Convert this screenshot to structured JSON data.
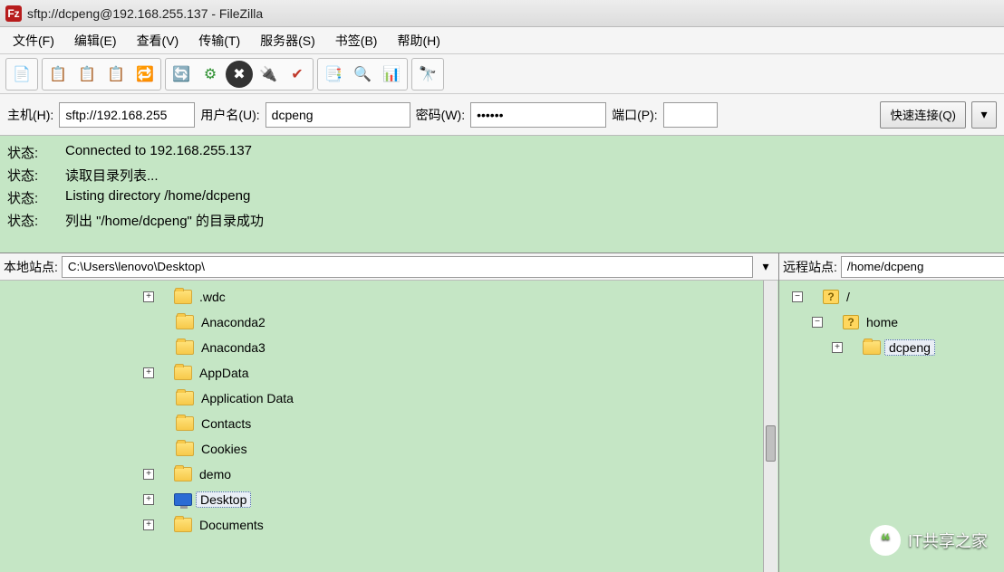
{
  "title": "sftp://dcpeng@192.168.255.137 - FileZilla",
  "menu": {
    "file": "文件(F)",
    "edit": "编辑(E)",
    "view": "查看(V)",
    "transfer": "传输(T)",
    "server": "服务器(S)",
    "bookmarks": "书签(B)",
    "help": "帮助(H)"
  },
  "quickconnect": {
    "host_label": "主机(H):",
    "host_value": "sftp://192.168.255",
    "user_label": "用户名(U):",
    "user_value": "dcpeng",
    "pass_label": "密码(W):",
    "pass_value": "••••••",
    "port_label": "端口(P):",
    "port_value": "",
    "button": "快速连接(Q)"
  },
  "log": [
    {
      "label": "状态:",
      "text": "Connected to 192.168.255.137"
    },
    {
      "label": "状态:",
      "text": "读取目录列表..."
    },
    {
      "label": "状态:",
      "text": "Listing directory /home/dcpeng"
    },
    {
      "label": "状态:",
      "text": "列出 \"/home/dcpeng\" 的目录成功"
    }
  ],
  "local": {
    "label": "本地站点:",
    "path": "C:\\Users\\lenovo\\Desktop\\",
    "tree": [
      {
        "name": ".wdc",
        "expander": "+",
        "icon": "folder",
        "indent": 1
      },
      {
        "name": "Anaconda2",
        "expander": "",
        "icon": "folder",
        "indent": 1
      },
      {
        "name": "Anaconda3",
        "expander": "",
        "icon": "folder",
        "indent": 1
      },
      {
        "name": "AppData",
        "expander": "+",
        "icon": "folder",
        "indent": 1
      },
      {
        "name": "Application Data",
        "expander": "",
        "icon": "folder",
        "indent": 1
      },
      {
        "name": "Contacts",
        "expander": "",
        "icon": "folder",
        "indent": 1
      },
      {
        "name": "Cookies",
        "expander": "",
        "icon": "folder",
        "indent": 1
      },
      {
        "name": "demo",
        "expander": "+",
        "icon": "folder",
        "indent": 1
      },
      {
        "name": "Desktop",
        "expander": "+",
        "icon": "monitor",
        "indent": 1,
        "selected": true
      },
      {
        "name": "Documents",
        "expander": "+",
        "icon": "folder",
        "indent": 1
      }
    ]
  },
  "remote": {
    "label": "远程站点:",
    "path": "/home/dcpeng",
    "tree": [
      {
        "name": "/",
        "expander": "−",
        "icon": "unknown",
        "indent": 0
      },
      {
        "name": "home",
        "expander": "−",
        "icon": "unknown",
        "indent": 1
      },
      {
        "name": "dcpeng",
        "expander": "+",
        "icon": "folder",
        "indent": 2,
        "selected": true
      }
    ]
  },
  "toolbar_icons": {
    "site_manager": "📄",
    "toggle_local": "📋",
    "toggle_remote": "📋",
    "toggle_queue": "📋",
    "sync_browse": "🔁",
    "refresh": "🔄",
    "process_queue": "⚙",
    "cancel": "✖",
    "disconnect": "🔌",
    "reconnect": "✔",
    "filter": "📑",
    "search": "🔍",
    "compare": "📊",
    "binoculars": "🔭"
  },
  "watermark": "IT共享之家"
}
